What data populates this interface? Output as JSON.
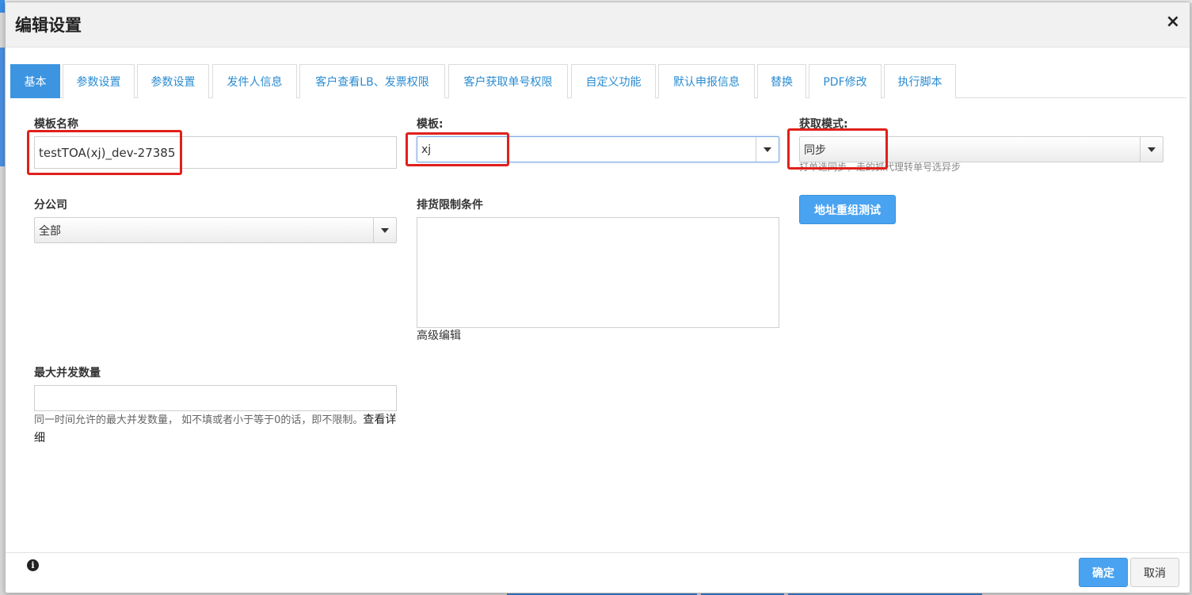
{
  "dialog": {
    "title": "编辑设置",
    "close_glyph": "×"
  },
  "tabs": [
    {
      "label": "基本",
      "active": true
    },
    {
      "label": "参数设置",
      "active": false
    },
    {
      "label": "参数设置",
      "active": false
    },
    {
      "label": "发件人信息",
      "active": false
    },
    {
      "label": "客户查看LB、发票权限",
      "active": false
    },
    {
      "label": "客户获取单号权限",
      "active": false
    },
    {
      "label": "自定义功能",
      "active": false
    },
    {
      "label": "默认申报信息",
      "active": false
    },
    {
      "label": "替换",
      "active": false
    },
    {
      "label": "PDF修改",
      "active": false
    },
    {
      "label": "执行脚本",
      "active": false
    }
  ],
  "form": {
    "template_name": {
      "label": "模板名称",
      "value": "testTOA(xj)_dev-27385"
    },
    "template": {
      "label": "模板:",
      "value": "xj"
    },
    "fetch_mode": {
      "label": "获取模式:",
      "value": "同步",
      "help": "打单选同步，走的抓代理转单号选异步"
    },
    "branch": {
      "label": "分公司",
      "value": "全部"
    },
    "shipping_restriction": {
      "label": "排货限制条件",
      "value": "",
      "advanced_edit": "高级编辑"
    },
    "address_test_button": "地址重组测试",
    "max_concurrency": {
      "label": "最大并发数量",
      "value": "",
      "help": "同一时间允许的最大并发数量， 如不填或者小于等于0的话，即不限制。",
      "help_link": "查看详细"
    }
  },
  "footer": {
    "info_icon": "info-icon",
    "confirm": "确定",
    "cancel": "取消"
  },
  "colors": {
    "accent": "#3d94e0",
    "highlight": "#e0201b",
    "tab_text": "#2a8cd1"
  }
}
